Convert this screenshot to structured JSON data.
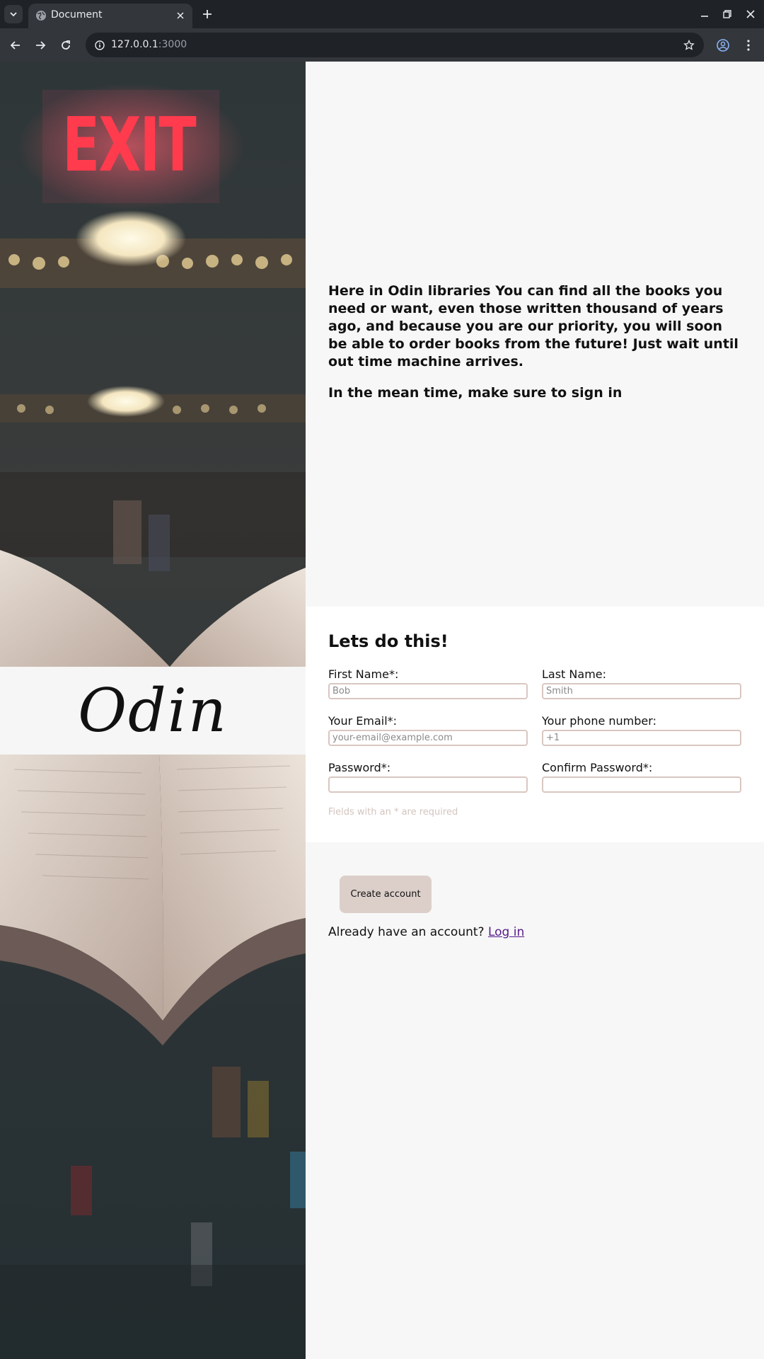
{
  "browser": {
    "tab_title": "Document",
    "url_host": "127.0.0.1",
    "url_port": ":3000"
  },
  "hero": {
    "exit_sign": "EXIT",
    "logo": "Odin"
  },
  "intro": {
    "paragraph_1": "Here in Odin libraries You can find all the books you need or want, even those written thousand of years ago, and because you are our priority, you will soon be able to order books from the future! Just wait until out time machine arrives.",
    "paragraph_2": "In the mean time, make sure to sign in"
  },
  "form": {
    "title": "Lets do this!",
    "first_name_label": "First Name*:",
    "first_name_placeholder": "Bob",
    "last_name_label": "Last Name:",
    "last_name_placeholder": "Smith",
    "email_label": "Your Email*:",
    "email_placeholder": "your-email@example.com",
    "phone_label": "Your phone number:",
    "phone_placeholder": "+1",
    "password_label": "Password*:",
    "confirm_password_label": "Confirm Password*:",
    "required_note": "Fields with an * are required"
  },
  "actions": {
    "create_account": "Create account",
    "have_account_text": "Already have an account?",
    "login_link": "Log in"
  },
  "colors": {
    "button_bg": "#dccfca",
    "input_border": "#d9c7c1",
    "link": "#551a8b",
    "exit_red": "#ff3b4d"
  }
}
